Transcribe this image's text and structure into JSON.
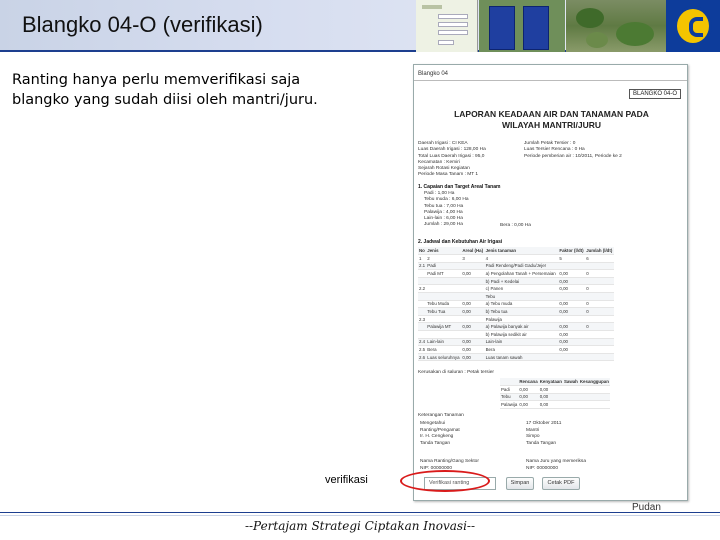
{
  "slide": {
    "title": "Blangko 04-O (verifikasi)",
    "intro_line1": "Ranting hanya perlu memverifikasi saja",
    "intro_line2": "blangko yang sudah diisi oleh mantri/juru.",
    "callout": "verifikasi",
    "footer": "--Pertajam Strategi Ciptakan Inovasi--",
    "corner": "Pudan"
  },
  "form": {
    "tab": "Blangko 04",
    "stamp": "BLANGKO 04-O",
    "title_line1": "LAPORAN KEADAAN AIR DAN TANAMAN PADA",
    "title_line2": "WILAYAH MANTRI/JURU",
    "info_left": [
      "Daerah Irigasi : CI KEA",
      "Luas Daerah Irigasi : 128,00 Ha",
      "Total Luas Daerah Irigasi : 95,0",
      "Kecamatan : Kemiri",
      "Sejarah Rotasi Kegiatan",
      "Periode Masa Tanam : MT 1"
    ],
    "info_right": [
      "Jumlah Petak Tersier : 0",
      "Luas Tersier Rencana : 0 Ha",
      "Periode pemberian air : 10/2011, Periode ke 2"
    ],
    "section1": "1. Capaian dan Target Areal Tanam",
    "targets": [
      "Padi : 1,00 Ha",
      "Tebu muda : 6,00 Ha",
      "Tebu tua : 7,00 Ha",
      "Palawija : 4,00 Ha",
      "Lain-lain : 6,00 Ha",
      "Jumlah : 29,00 Ha"
    ],
    "target_extra": "Bera : 0,00 Ha",
    "section2": "2. Jadwal dan Kebutuhan Air Irigasi",
    "table_head": [
      "No",
      "Jenis",
      "Areal (Ha)",
      "Jenis tanaman",
      "Faktor (l/dt)",
      "Jumlah (l/dt)"
    ],
    "table_rows": [
      [
        "1",
        "2",
        "3",
        "4",
        "5",
        "6"
      ],
      [
        "2.1",
        "Padi",
        "",
        "Padi Rendeng/Padi Gadu/Jejer",
        "",
        ""
      ],
      [
        "",
        "Padi MT",
        "0,00",
        "a) Pengolahan Tanah + Persemaian",
        "0,00",
        "0"
      ],
      [
        "",
        "",
        "",
        "b) Padi + Kedelai",
        "0,00",
        ""
      ],
      [
        "2.2",
        "",
        "",
        "c) Panen",
        "0,00",
        "0"
      ],
      [
        "",
        "",
        "",
        "Tebu",
        "",
        ""
      ],
      [
        "",
        "Tebu Muda",
        "0,00",
        "a) Tebu muda",
        "0,00",
        "0"
      ],
      [
        "",
        "Tebu Tua",
        "0,00",
        "b) Tebu tua",
        "0,00",
        "0"
      ],
      [
        "2.3",
        "",
        "",
        "Palawija",
        "",
        ""
      ],
      [
        "",
        "Palawija MT",
        "0,00",
        "a) Palawija banyak air",
        "0,00",
        "0"
      ],
      [
        "",
        "",
        "",
        "b) Palawija sedikit air",
        "0,00",
        ""
      ],
      [
        "2.4",
        "Lain-lain",
        "0,00",
        "Lain-lain",
        "0,00",
        ""
      ],
      [
        "2.5",
        "Bera",
        "0,00",
        "Bera",
        "0,00",
        ""
      ],
      [
        "2.6",
        "Luas seluruhnya",
        "0,00",
        "Luas tanam sawah",
        "",
        ""
      ]
    ],
    "checkbox_row": "Kerusakan di saluran : Petak tersier",
    "mini_table_head": [
      "",
      "Rencana",
      "Kenyataan",
      "Sawah",
      "Kesanggupan"
    ],
    "mini_table": [
      [
        "Padi",
        "0,00",
        "0,00"
      ],
      [
        "Tebu",
        "0,00",
        "0,00"
      ],
      [
        "Palawija",
        "0,00",
        "0,00"
      ]
    ],
    "keterangan": "Keterangan Tanaman",
    "sign_left": [
      "Mengetahui",
      "Ranting/Pengamat",
      "Ir. H. Cengkeng",
      "Tanda Tangan"
    ],
    "sign_right": [
      "17 Oktober 2011",
      "Mantri",
      "Simpo",
      "Tanda Tangan"
    ],
    "verifier_left": [
      "Nama Ranting/Gang Sektor",
      "NIP: 00000000"
    ],
    "verifier_right": [
      "Nama Juru yang memeriksa",
      "NIP: 00000000"
    ],
    "select_value": "Verifikasi ranting",
    "btn_simpan": "Simpan",
    "btn_cetak": "Cetak PDF"
  }
}
